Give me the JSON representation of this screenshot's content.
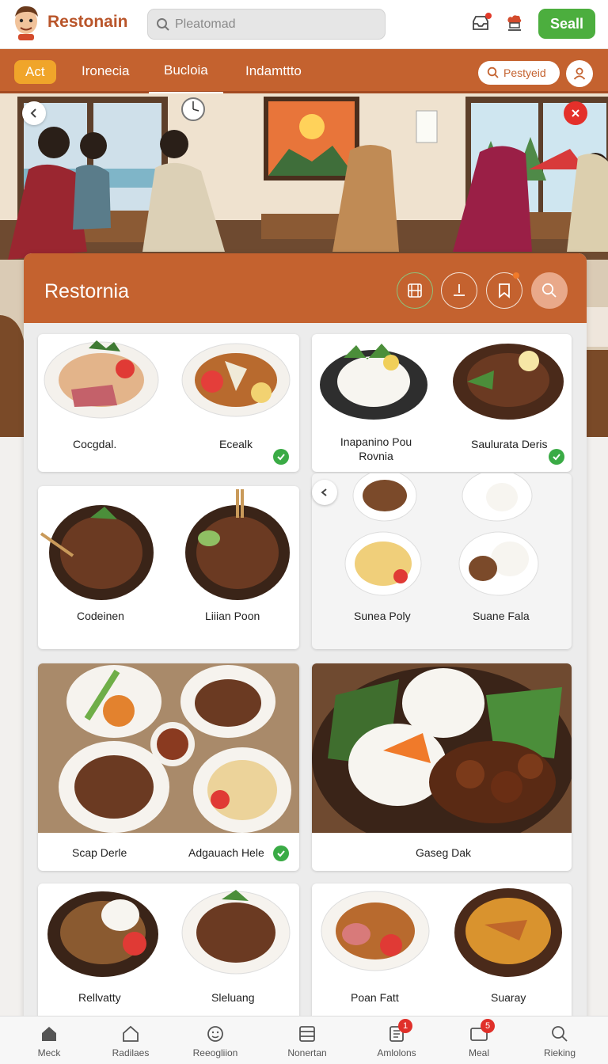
{
  "app": {
    "name": "Restonain",
    "search_placeholder": "Pleatomad",
    "sell_label": "Seall"
  },
  "nav": {
    "tabs": [
      {
        "label": "Act"
      },
      {
        "label": "Ironecia"
      },
      {
        "label": "Bucloia"
      },
      {
        "label": "Indamttto"
      }
    ],
    "post_placeholder": "Pestyeid"
  },
  "restaurant": {
    "title": "Restornia"
  },
  "menu": [
    {
      "caption": "Cocgdal."
    },
    {
      "caption": "Ecealk"
    },
    {
      "caption": "Inapanino Pou Rovnia"
    },
    {
      "caption": "Saulurata Deris"
    },
    {
      "caption": "Codeinen"
    },
    {
      "caption": "Liiian Poon"
    },
    {
      "caption": "Sunea Poly"
    },
    {
      "caption": "Suane Fala"
    },
    {
      "caption": "Scap Derle"
    },
    {
      "caption": "Adgauach Hele"
    },
    {
      "caption": "Gaseg Dak"
    },
    {
      "caption": "Rellvatty"
    },
    {
      "caption": "Sleluang"
    },
    {
      "caption": "Poan Fatt"
    },
    {
      "caption": "Suaray"
    }
  ],
  "tabbar": [
    {
      "label": "Meck",
      "icon": "home-icon"
    },
    {
      "label": "Radilaes",
      "icon": "house-outline-icon"
    },
    {
      "label": "Reeogliion",
      "icon": "face-icon"
    },
    {
      "label": "Nonertan",
      "icon": "list-icon"
    },
    {
      "label": "Amlolons",
      "icon": "notes-icon",
      "badge": "1"
    },
    {
      "label": "Meal",
      "icon": "card-icon",
      "badge": "5"
    },
    {
      "label": "Rieking",
      "icon": "search-icon"
    }
  ],
  "colors": {
    "brand": "#c4622f",
    "accent": "#f0a52a",
    "success": "#4cae3e",
    "alert": "#e0302a"
  }
}
